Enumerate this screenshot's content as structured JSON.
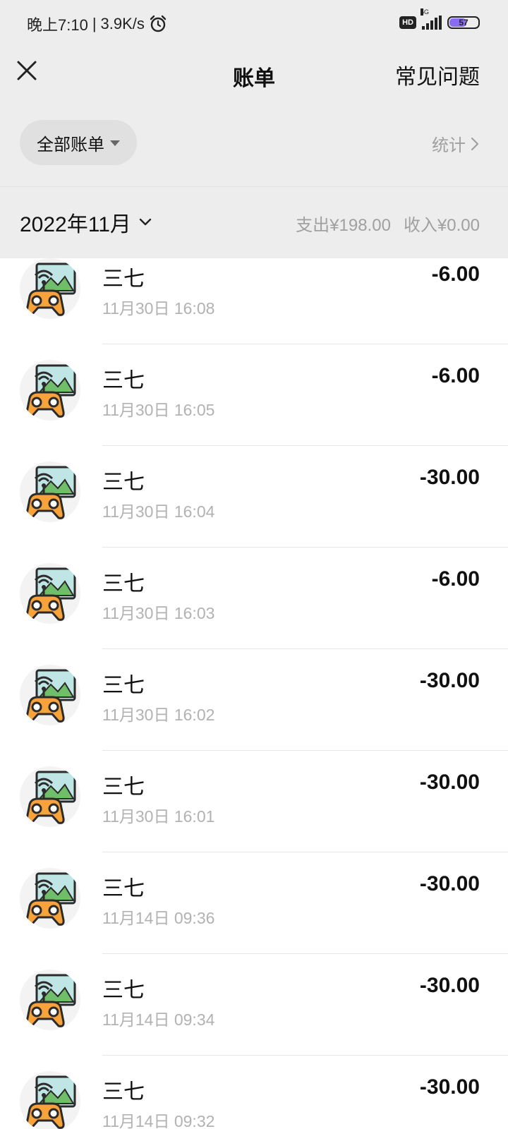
{
  "status": {
    "time": "晚上7:10",
    "speed": "3.9K/s",
    "hd": "HD",
    "network": "5G",
    "battery": "57"
  },
  "nav": {
    "title": "账单",
    "faq": "常见问题"
  },
  "filter": {
    "label": "全部账单",
    "stats": "统计"
  },
  "month": {
    "label": "2022年11月",
    "expense": "支出¥198.00",
    "income": "收入¥0.00"
  },
  "transactions": [
    {
      "merchant": "三七",
      "time": "11月30日 16:08",
      "amount": "-6.00"
    },
    {
      "merchant": "三七",
      "time": "11月30日 16:05",
      "amount": "-6.00"
    },
    {
      "merchant": "三七",
      "time": "11月30日 16:04",
      "amount": "-30.00"
    },
    {
      "merchant": "三七",
      "time": "11月30日 16:03",
      "amount": "-6.00"
    },
    {
      "merchant": "三七",
      "time": "11月30日 16:02",
      "amount": "-30.00"
    },
    {
      "merchant": "三七",
      "time": "11月30日 16:01",
      "amount": "-30.00"
    },
    {
      "merchant": "三七",
      "time": "11月14日 09:36",
      "amount": "-30.00"
    },
    {
      "merchant": "三七",
      "time": "11月14日 09:34",
      "amount": "-30.00"
    },
    {
      "merchant": "三七",
      "time": "11月14日 09:32",
      "amount": "-30.00"
    }
  ]
}
